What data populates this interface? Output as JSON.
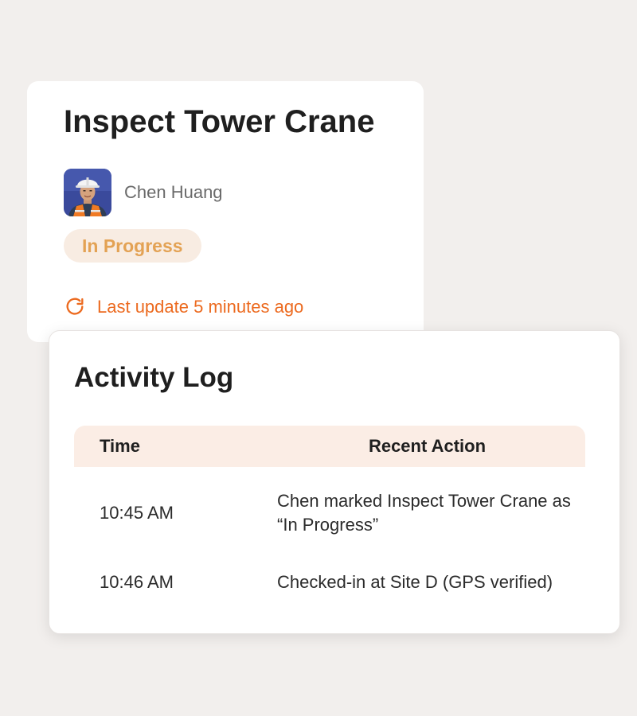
{
  "task": {
    "title": "Inspect Tower Crane",
    "assignee": {
      "name": "Chen Huang",
      "avatar_icon": "worker-hardhat-avatar"
    },
    "status": "In Progress",
    "last_update": "Last update 5 minutes ago",
    "refresh_icon": "refresh-icon"
  },
  "activity_log": {
    "title": "Activity Log",
    "columns": [
      "Time",
      "Recent Action"
    ],
    "rows": [
      {
        "time": "10:45 AM",
        "action": "Chen marked Inspect Tower Crane as “In Progress”"
      },
      {
        "time": "10:46 AM",
        "action": "Checked-in at Site D (GPS verified)"
      }
    ]
  },
  "colors": {
    "page_background": "#f2efed",
    "card_background": "#ffffff",
    "status_badge_background": "#f8ece2",
    "status_badge_text": "#e3a254",
    "accent_orange": "#ec6a1f",
    "table_header_background": "#fbede5",
    "avatar_background": "#3a4a9c"
  }
}
